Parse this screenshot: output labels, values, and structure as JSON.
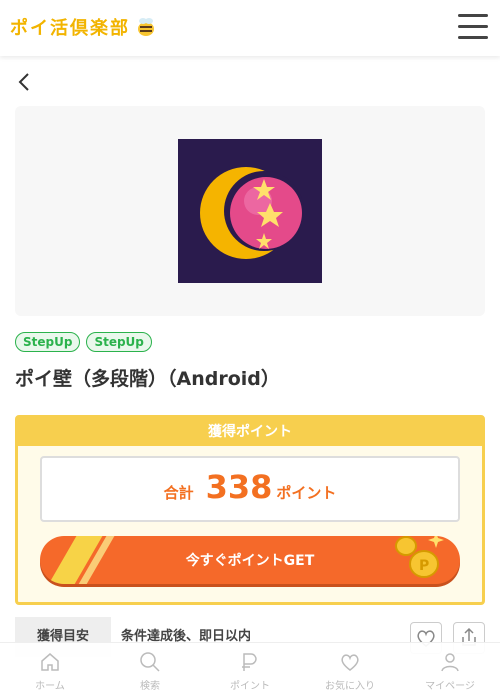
{
  "header": {
    "logo_text": "ポイ活倶楽部",
    "logo_icon": "bee-icon",
    "menu_icon": "hamburger-icon"
  },
  "nav": {
    "back_icon": "chevron-left-icon"
  },
  "offer": {
    "tags": [
      "StepUp",
      "StepUp"
    ],
    "title": "ポイ壁（多段階）（Android）"
  },
  "points": {
    "header": "獲得ポイント",
    "total_label": "合計",
    "total_value": "338",
    "unit": "ポイント",
    "button_label": "今すぐポイントGET"
  },
  "info": {
    "label": "獲得目安",
    "value": "条件達成後、即日以内"
  },
  "bottom_nav": [
    {
      "label": "ホーム",
      "icon": "home-icon"
    },
    {
      "label": "検索",
      "icon": "search-icon"
    },
    {
      "label": "ポイント",
      "icon": "point-icon"
    },
    {
      "label": "お気に入り",
      "icon": "heart-icon"
    },
    {
      "label": "マイページ",
      "icon": "user-icon"
    }
  ],
  "colors": {
    "accent": "#f37021",
    "gold": "#f7cf4e",
    "tag_green": "#2bb24c"
  }
}
